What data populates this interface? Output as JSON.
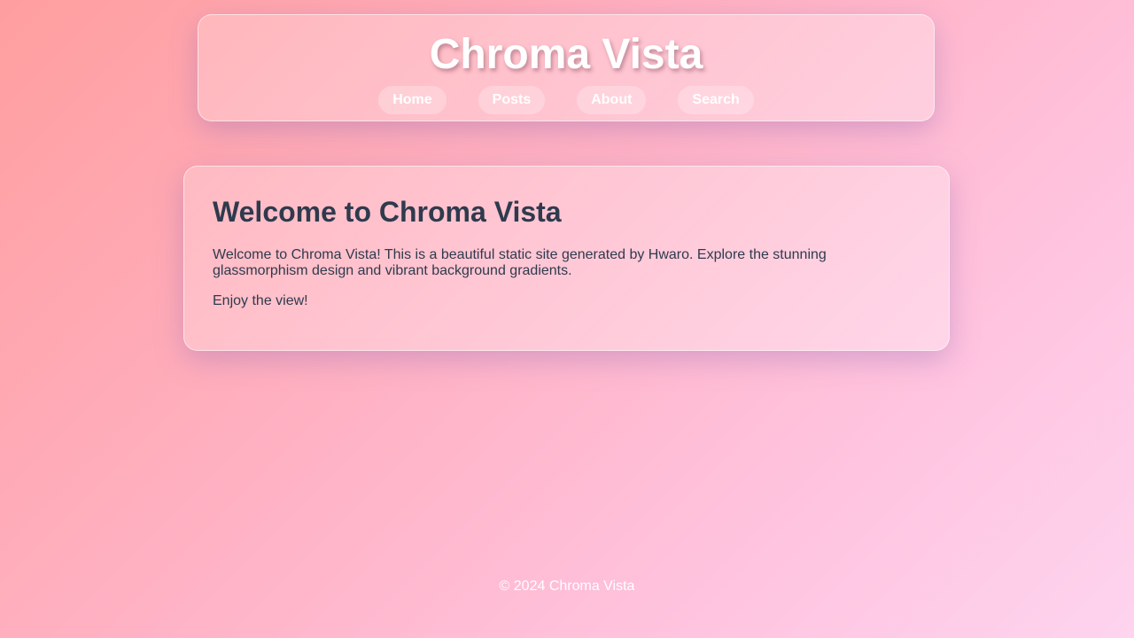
{
  "header": {
    "title": "Chroma Vista",
    "nav": [
      "Home",
      "Posts",
      "About",
      "Search"
    ]
  },
  "main": {
    "heading": "Welcome to Chroma Vista",
    "paragraphs": [
      "Welcome to Chroma Vista! This is a beautiful static site generated by Hwaro. Explore the stunning glassmorphism design and vibrant background gradients.",
      "Enjoy the view!"
    ]
  },
  "footer": {
    "text": "© 2024 Chroma Vista"
  },
  "colors": {
    "background_start": "#ff9e9f",
    "background_end": "#fed4ee",
    "text_dark": "#2f3a4d",
    "text_light": "#ffffff"
  }
}
